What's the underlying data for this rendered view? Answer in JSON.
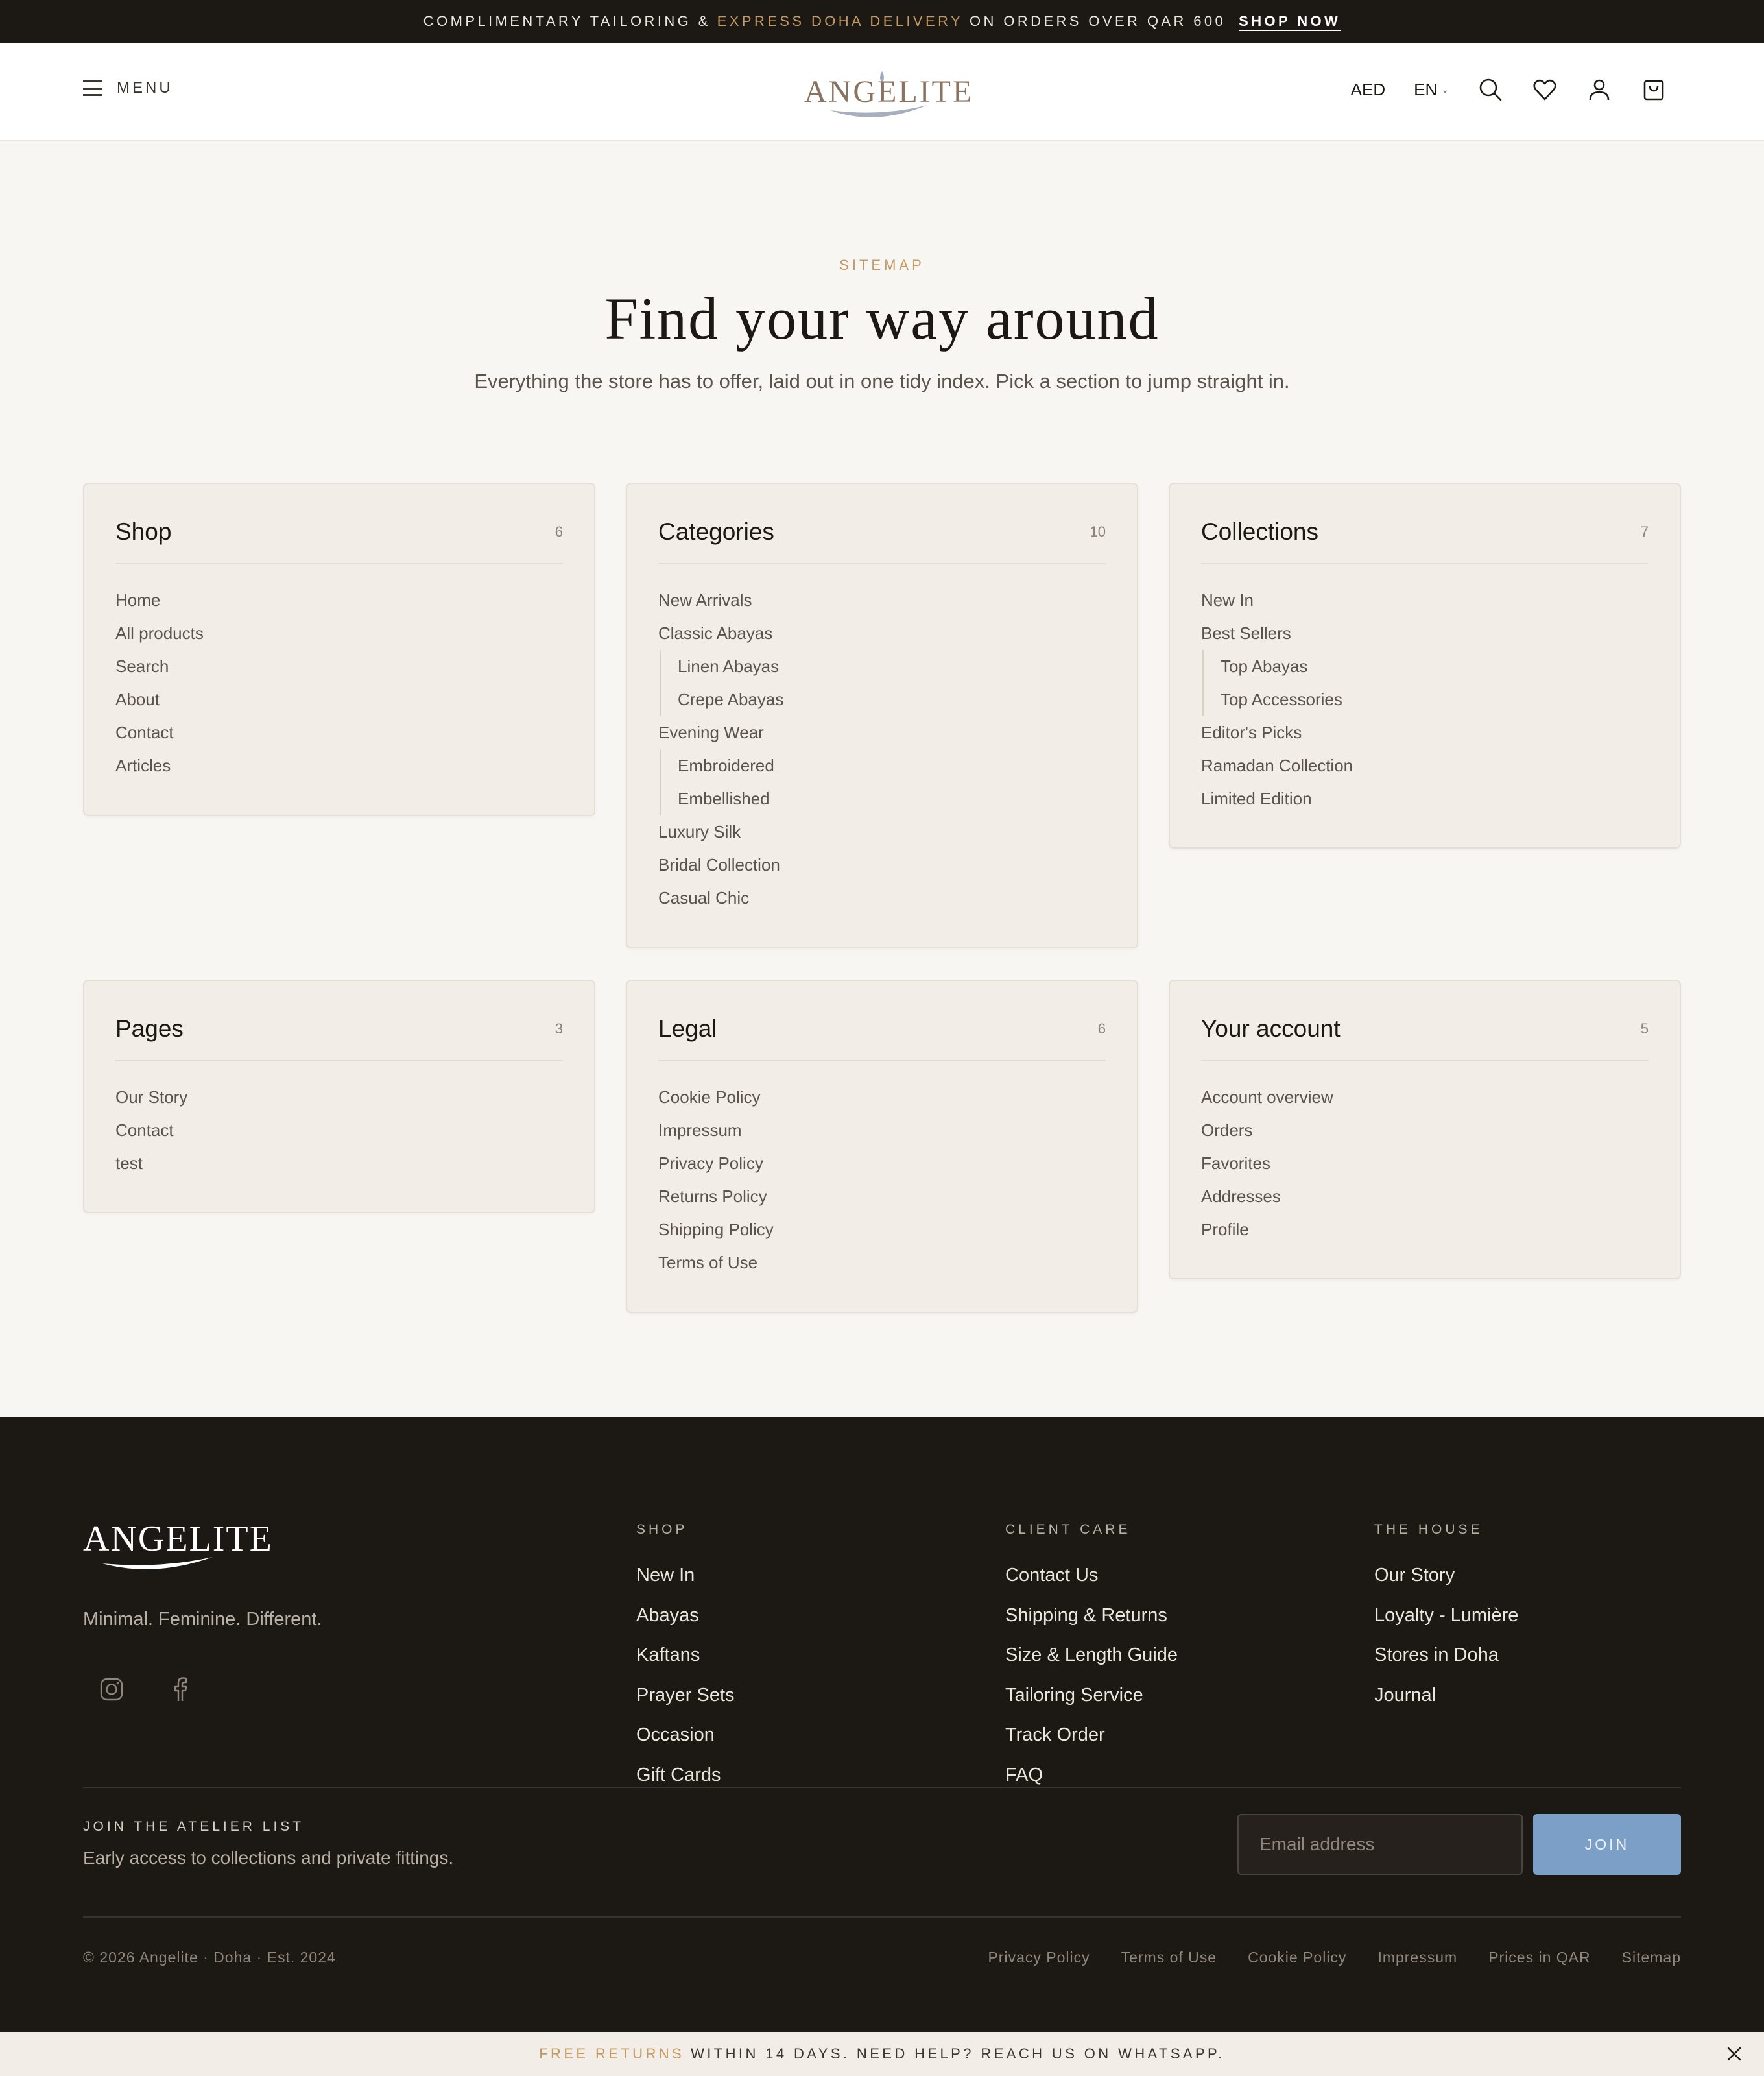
{
  "announcement": {
    "prefix": "COMPLIMENTARY TAILORING &",
    "accent": "EXPRESS DOHA DELIVERY",
    "suffix": "ON ORDERS OVER QAR 600",
    "cta": "SHOP NOW"
  },
  "header": {
    "menu_label": "MENU",
    "logo_text": "ANGELITE",
    "currency": "AED",
    "language": "EN",
    "icons": [
      "search-icon",
      "heart-icon",
      "user-icon",
      "bag-icon"
    ]
  },
  "hero": {
    "eyebrow": "SITEMAP",
    "title": "Find your way around",
    "subtitle": "Everything the store has to offer, laid out in one tidy index. Pick a section to jump straight in."
  },
  "cards": [
    {
      "title": "Shop",
      "count": "6",
      "items": [
        {
          "label": "Home",
          "sub": false
        },
        {
          "label": "All products",
          "sub": false
        },
        {
          "label": "Search",
          "sub": false
        },
        {
          "label": "About",
          "sub": false
        },
        {
          "label": "Contact",
          "sub": false
        },
        {
          "label": "Articles",
          "sub": false
        }
      ]
    },
    {
      "title": "Categories",
      "count": "10",
      "items": [
        {
          "label": "New Arrivals",
          "sub": false
        },
        {
          "label": "Classic Abayas",
          "sub": false
        },
        {
          "label": "Linen Abayas",
          "sub": true
        },
        {
          "label": "Crepe Abayas",
          "sub": true
        },
        {
          "label": "Evening Wear",
          "sub": false
        },
        {
          "label": "Embroidered",
          "sub": true
        },
        {
          "label": "Embellished",
          "sub": true
        },
        {
          "label": "Luxury Silk",
          "sub": false
        },
        {
          "label": "Bridal Collection",
          "sub": false
        },
        {
          "label": "Casual Chic",
          "sub": false
        }
      ]
    },
    {
      "title": "Collections",
      "count": "7",
      "items": [
        {
          "label": "New In",
          "sub": false
        },
        {
          "label": "Best Sellers",
          "sub": false
        },
        {
          "label": "Top Abayas",
          "sub": true
        },
        {
          "label": "Top Accessories",
          "sub": true
        },
        {
          "label": "Editor's Picks",
          "sub": false
        },
        {
          "label": "Ramadan Collection",
          "sub": false
        },
        {
          "label": "Limited Edition",
          "sub": false
        }
      ]
    },
    {
      "title": "Pages",
      "count": "3",
      "items": [
        {
          "label": "Our Story",
          "sub": false
        },
        {
          "label": "Contact",
          "sub": false
        },
        {
          "label": "test",
          "sub": false
        }
      ]
    },
    {
      "title": "Legal",
      "count": "6",
      "items": [
        {
          "label": "Cookie Policy",
          "sub": false
        },
        {
          "label": "Impressum",
          "sub": false
        },
        {
          "label": "Privacy Policy",
          "sub": false
        },
        {
          "label": "Returns Policy",
          "sub": false
        },
        {
          "label": "Shipping Policy",
          "sub": false
        },
        {
          "label": "Terms of Use",
          "sub": false
        }
      ]
    },
    {
      "title": "Your account",
      "count": "5",
      "items": [
        {
          "label": "Account overview",
          "sub": false
        },
        {
          "label": "Orders",
          "sub": false
        },
        {
          "label": "Favorites",
          "sub": false
        },
        {
          "label": "Addresses",
          "sub": false
        },
        {
          "label": "Profile",
          "sub": false
        }
      ]
    }
  ],
  "footer": {
    "logo_text": "ANGELITE",
    "tagline": "Minimal. Feminine. Different.",
    "social": [
      "instagram-icon",
      "facebook-icon"
    ],
    "columns": [
      {
        "title": "SHOP",
        "items": [
          "New In",
          "Abayas",
          "Kaftans",
          "Prayer Sets",
          "Occasion",
          "Gift Cards"
        ]
      },
      {
        "title": "CLIENT CARE",
        "items": [
          "Contact Us",
          "Shipping & Returns",
          "Size & Length Guide",
          "Tailoring Service",
          "Track Order",
          "FAQ"
        ]
      },
      {
        "title": "THE HOUSE",
        "items": [
          "Our Story",
          "Loyalty - Lumière",
          "Stores in Doha",
          "Journal"
        ]
      }
    ],
    "newsletter": {
      "title": "JOIN THE ATELIER LIST",
      "subtitle": "Early access to collections and private fittings.",
      "placeholder": "Email address",
      "button": "JOIN"
    },
    "copyright": "© 2026 Angelite · Doha · Est. 2024",
    "legal_links": [
      "Privacy Policy",
      "Terms of Use",
      "Cookie Policy",
      "Impressum",
      "Prices in QAR",
      "Sitemap"
    ]
  },
  "bottom_bar": {
    "accent": "FREE RETURNS",
    "text": "WITHIN 14 DAYS. NEED HELP? REACH US ON WHATSAPP."
  },
  "colors": {
    "dark": "#1c1814",
    "accent_gold": "#c39a63",
    "card_bg": "#f2ede6",
    "page_bg": "#f8f6f2",
    "join_blue": "#7b9fc6"
  }
}
